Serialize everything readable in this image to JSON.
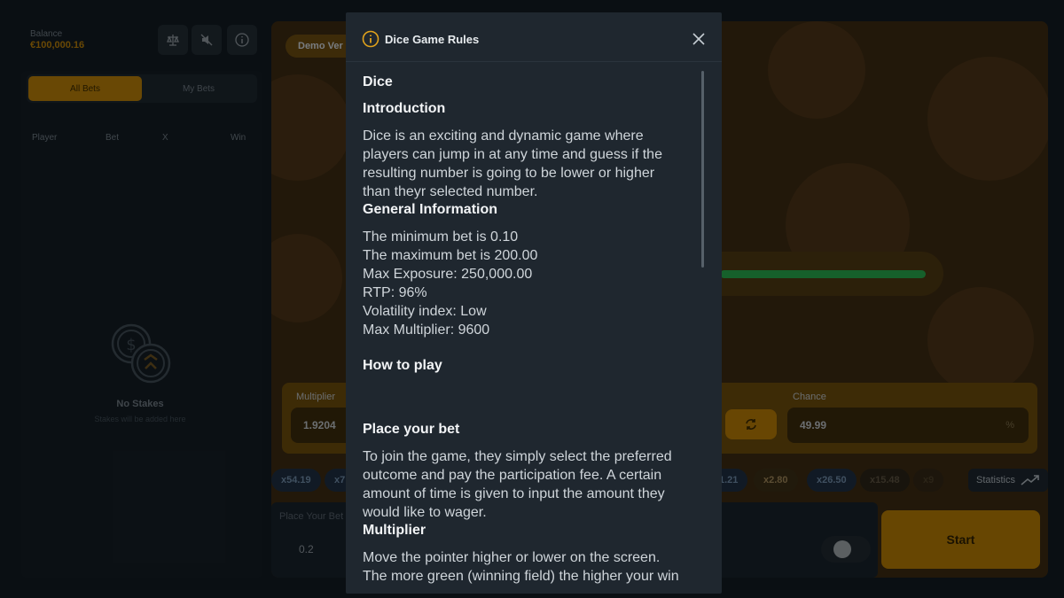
{
  "header": {
    "balance_label": "Balance",
    "balance_value": "€100,000.16",
    "icons": [
      "balance-scale-icon",
      "sound-off-icon",
      "info-icon"
    ]
  },
  "bets": {
    "tabs": [
      "All Bets",
      "My Bets"
    ],
    "active_tab": "All Bets",
    "columns": [
      "Player",
      "Bet",
      "X",
      "Win"
    ],
    "empty_title": "No Stakes",
    "empty_subtitle": "Stakes will be added here"
  },
  "game": {
    "demo_label": "Demo Ver",
    "multiplier_label": "Multiplier",
    "multiplier_value": "1.9204",
    "chance_label": "Chance",
    "chance_value": "49.99",
    "chance_unit": "%",
    "history_left": [
      "x54.19",
      "x7"
    ],
    "history_right": [
      "1.21",
      "x2.80",
      "x26.50",
      "x15.48",
      "x9"
    ],
    "statistics_label": "Statistics",
    "bet_label": "Place Your Bet",
    "bet_value": "0.2",
    "start_label": "Start"
  },
  "modal": {
    "title": "Dice Game Rules",
    "h_dice": "Dice",
    "h_intro": "Introduction",
    "intro_lines": [
      "Dice is an exciting and dynamic game where",
      "players can jump in at any time and guess if the",
      "resulting number is going to be lower or higher",
      "than theyr selected number."
    ],
    "h_general": "General Information",
    "general_lines": [
      "The minimum bet is 0.10",
      "The maximum bet is 200.00",
      "Max Exposure: 250,000.00",
      "RTP: 96%",
      "Volatility index: Low",
      "Max Multiplier: 9600"
    ],
    "h_howto": "How to play",
    "h_place": "Place your bet",
    "place_lines": [
      "To join the game, they simply select the preferred",
      "outcome and pay the participation fee. A certain",
      "amount of time is given to input the amount they",
      "would like to wager."
    ],
    "h_multiplier": "Multiplier",
    "multiplier_lines": [
      "Move the pointer higher or lower on the screen.",
      "The more green (winning field) the higher your win"
    ]
  },
  "colors": {
    "accent": "#b57d09",
    "green": "#27a64a",
    "modal_bg": "#1f272f"
  }
}
